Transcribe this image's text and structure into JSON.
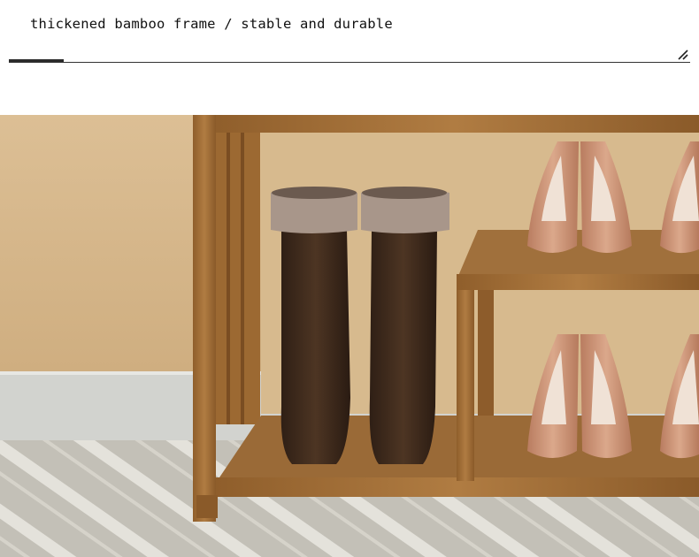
{
  "header": {
    "caption": "thickened bamboo frame / stable and durable",
    "icon": "resize-handle-icon"
  },
  "photo": {
    "subject": "bamboo shoe rack with boots and high heels",
    "colors": {
      "wall": "#d9bc92",
      "baseboard": "#cfd0cc",
      "carpet": "#c9c6bd",
      "bamboo": "#a8743a",
      "boot": "#3e2a1c",
      "heel": "#d09a7c"
    }
  }
}
